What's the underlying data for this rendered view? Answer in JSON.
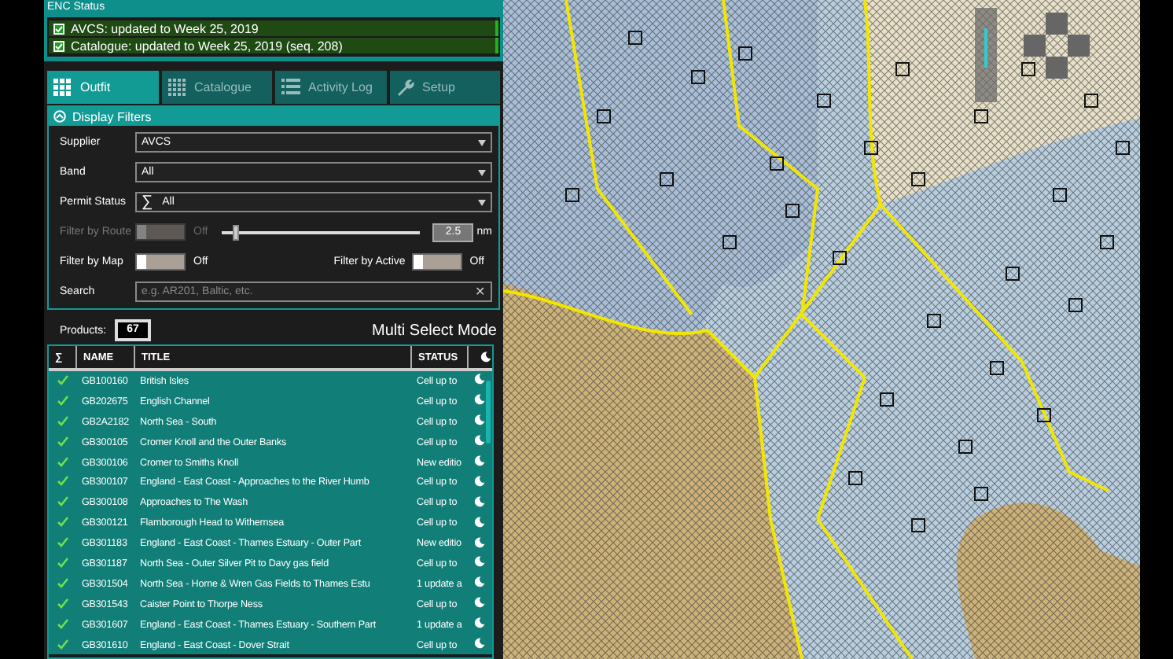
{
  "enc_status": {
    "title": "ENC Status",
    "items": [
      {
        "text": "AVCS: updated to Week 25, 2019",
        "checked": true
      },
      {
        "text": "Catalogue: updated to Week 25, 2019 (seq. 208)",
        "checked": true
      }
    ]
  },
  "tabs": [
    {
      "label": "Outfit",
      "selected": true
    },
    {
      "label": "Catalogue",
      "selected": false
    },
    {
      "label": "Activity Log",
      "selected": false
    },
    {
      "label": "Setup",
      "selected": false
    }
  ],
  "display_filters": {
    "title": "Display Filters",
    "expanded": true,
    "supplier": {
      "label": "Supplier",
      "value": "AVCS"
    },
    "band": {
      "label": "Band",
      "value": "All"
    },
    "permit_status": {
      "label": "Permit Status",
      "symbol": "∑",
      "value": "All"
    },
    "filter_by_route": {
      "label": "Filter by Route",
      "on": false,
      "disabled": true,
      "state_text": "Off",
      "distance": {
        "level": 0.07,
        "value": "2.5",
        "unit": "nm"
      }
    },
    "filter_by_map": {
      "label": "Filter by Map",
      "on": false,
      "state_text": "Off"
    },
    "filter_by_active": {
      "label": "Filter by Active",
      "on": false,
      "state_text": "Off"
    },
    "search": {
      "label": "Search",
      "placeholder": "e.g. AR201, Baltic, etc.",
      "clear": "✕"
    }
  },
  "products": {
    "label": "Products:",
    "count": "67"
  },
  "mode": "Multi Select Mode",
  "table": {
    "columns": [
      "∑",
      "NAME",
      "TITLE",
      "STATUS"
    ],
    "rows": [
      {
        "checked": true,
        "selected": true,
        "name": "GB100160",
        "title": "British Isles",
        "status": "Cell up to"
      },
      {
        "checked": true,
        "selected": true,
        "name": "GB202675",
        "title": "English Channel",
        "status": "Cell up to"
      },
      {
        "checked": true,
        "selected": true,
        "name": "GB2A2182",
        "title": "North Sea - South",
        "status": "Cell up to"
      },
      {
        "checked": true,
        "selected": true,
        "name": "GB300105",
        "title": "Cromer Knoll and the Outer Banks",
        "status": "Cell up to"
      },
      {
        "checked": true,
        "selected": true,
        "name": "GB300106",
        "title": "Cromer to Smiths Knoll",
        "status": "New editio"
      },
      {
        "checked": true,
        "selected": true,
        "name": "GB300107",
        "title": "England - East Coast - Approaches to the River Humb",
        "status": "Cell up to"
      },
      {
        "checked": true,
        "selected": true,
        "name": "GB300108",
        "title": "Approaches to The Wash",
        "status": "Cell up to"
      },
      {
        "checked": true,
        "selected": true,
        "name": "GB300121",
        "title": "Flamborough Head to Withernsea",
        "status": "Cell up to"
      },
      {
        "checked": true,
        "selected": true,
        "name": "GB301183",
        "title": "England - East Coast - Thames Estuary - Outer Part",
        "status": "New editio"
      },
      {
        "checked": true,
        "selected": true,
        "name": "GB301187",
        "title": "North Sea - Outer Silver Pit to Davy gas field",
        "status": "Cell up to"
      },
      {
        "checked": true,
        "selected": true,
        "name": "GB301504",
        "title": "North Sea - Horne & Wren Gas Fields to Thames Estu",
        "status": "1 update a"
      },
      {
        "checked": true,
        "selected": true,
        "name": "GB301543",
        "title": "Caister Point to Thorpe Ness",
        "status": "Cell up to"
      },
      {
        "checked": true,
        "selected": true,
        "name": "GB301607",
        "title": "England - East Coast - Thames Estuary - Southern Part",
        "status": "1 update a"
      },
      {
        "checked": true,
        "selected": true,
        "name": "GB301610",
        "title": "England - East Coast - Dover Strait",
        "status": "Cell up to"
      }
    ]
  }
}
